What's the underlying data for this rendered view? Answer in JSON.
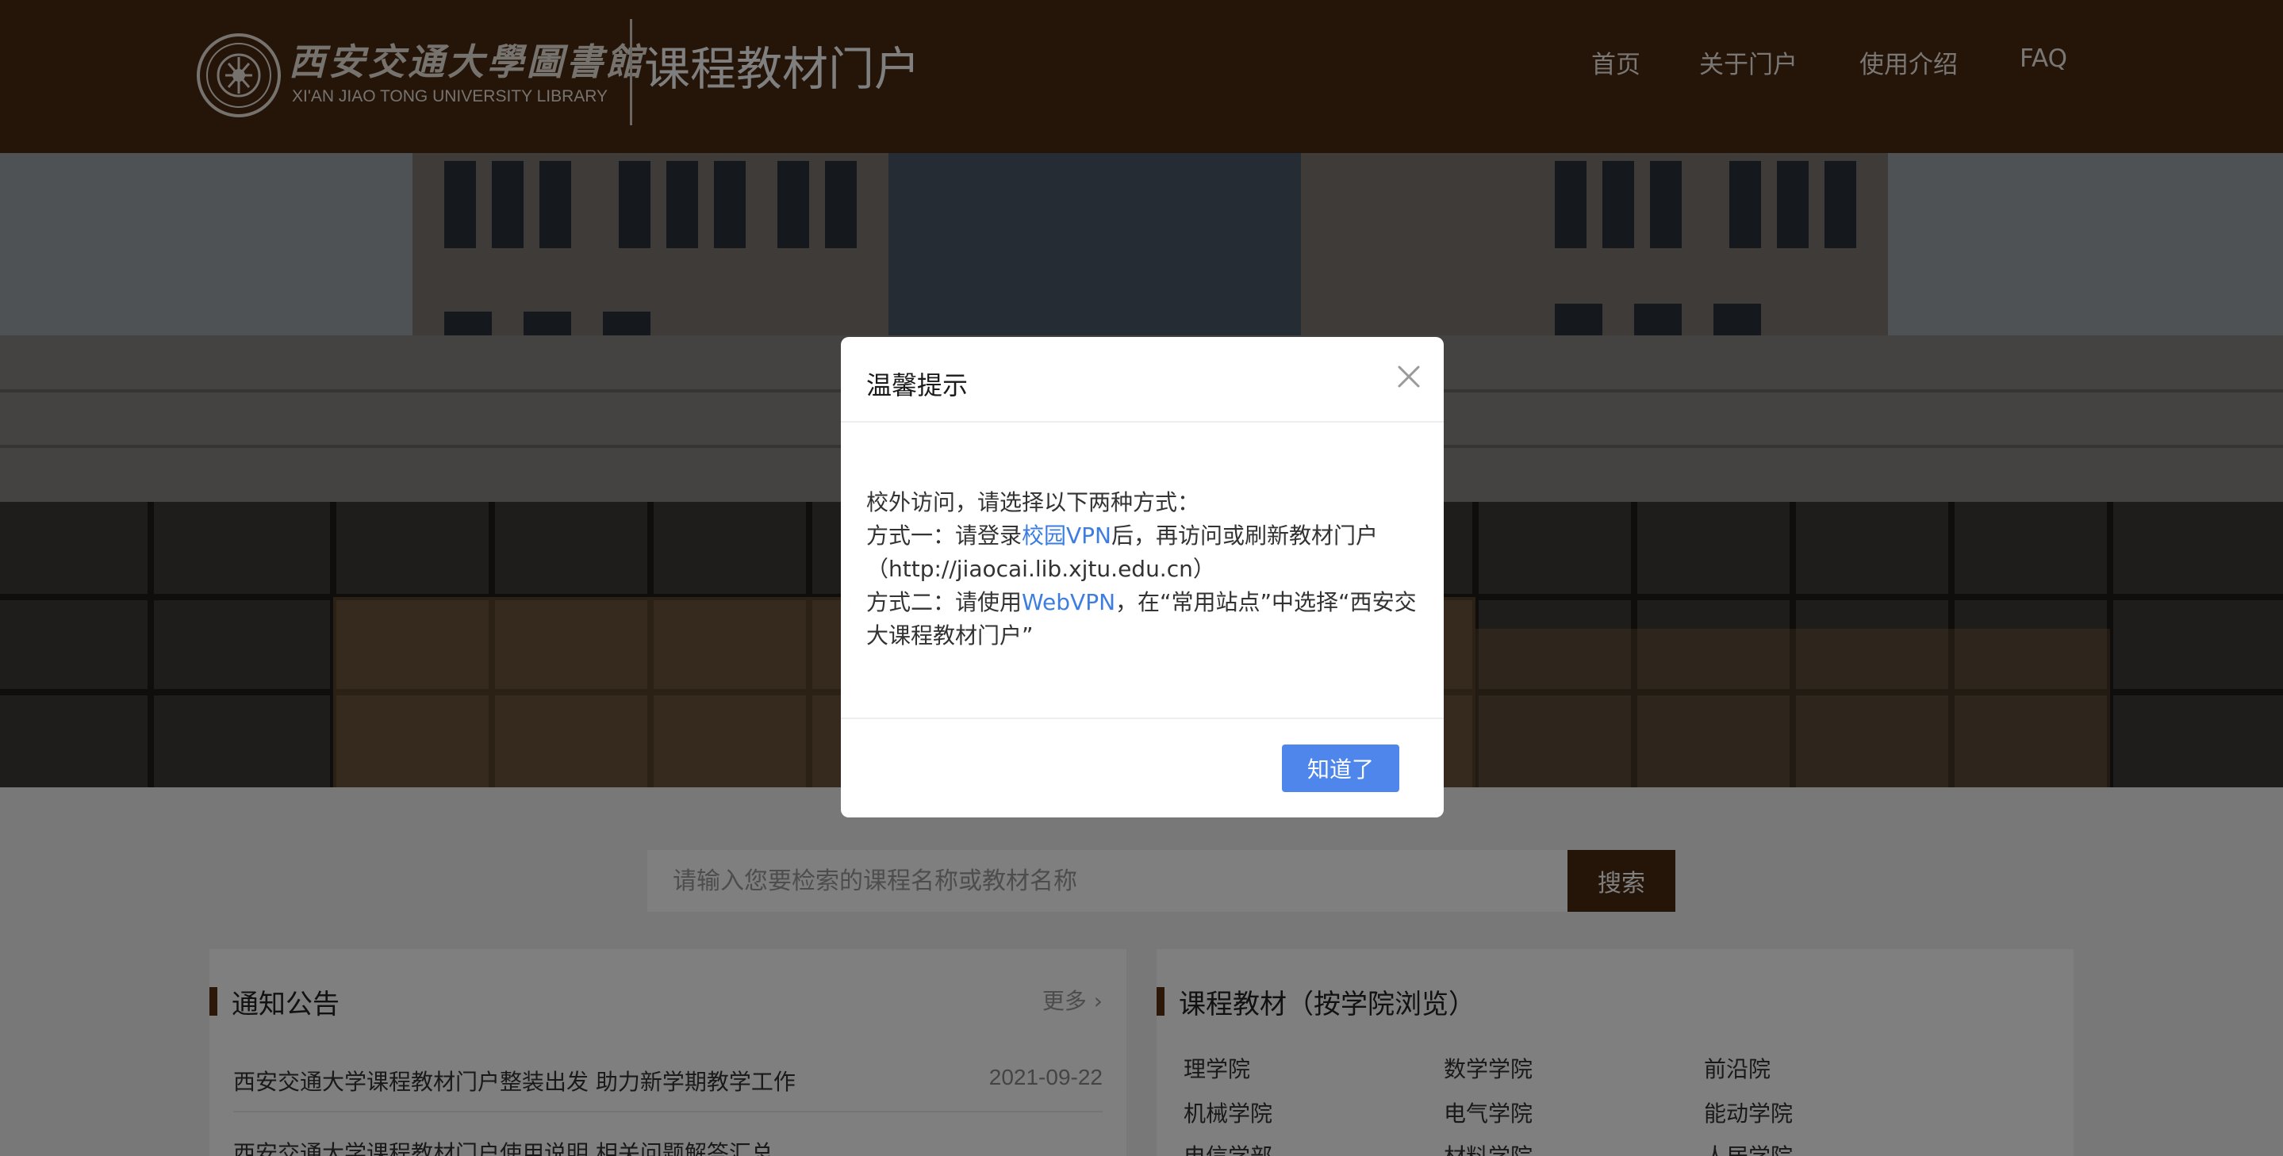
{
  "header": {
    "logo_cn": "西安交通大學圖書館",
    "logo_en": "XI'AN JIAO TONG UNIVERSITY LIBRARY",
    "portal_title": "课程教材门户",
    "nav": {
      "home": "首页",
      "about": "关于门户",
      "guide": "使用介绍",
      "faq": "FAQ"
    },
    "background_color": "#4a2a13"
  },
  "search": {
    "placeholder": "请输入您要检索的课程名称或教材名称",
    "button_label": "搜索",
    "button_color": "#4a2a13"
  },
  "notice": {
    "title": "通知公告",
    "more_label": "更多 ›",
    "items": [
      {
        "title": "西安交通大学课程教材门户整装出发 助力新学期教学工作",
        "date": "2021-09-22"
      },
      {
        "title": "西安交通大学课程教材门户使用说明 相关问题解答汇总"
      }
    ]
  },
  "courses": {
    "title": "课程教材（按学院浏览）",
    "colleges": [
      "理学院",
      "数学学院",
      "前沿院",
      "机械学院",
      "电气学院",
      "能动学院",
      "电信学部",
      "材料学院",
      "人居学院"
    ]
  },
  "modal": {
    "title": "温馨提示",
    "intro": "校外访问，请选择以下两种方式：",
    "method1_prefix": "方式一：请登录",
    "method1_link": "校园VPN",
    "method1_suffix": "后，再访问或刷新教材门户",
    "method1_url": "（http://jiaocai.lib.xjtu.edu.cn）",
    "method2_prefix": "方式二：请使用",
    "method2_link": "WebVPN",
    "method2_suffix": "，在“常用站点”中选择“西安交",
    "method2_suffix2": "大课程教材门户”",
    "ok_label": "知道了",
    "link_color": "#3d7de0",
    "button_color": "#4f86ec"
  }
}
